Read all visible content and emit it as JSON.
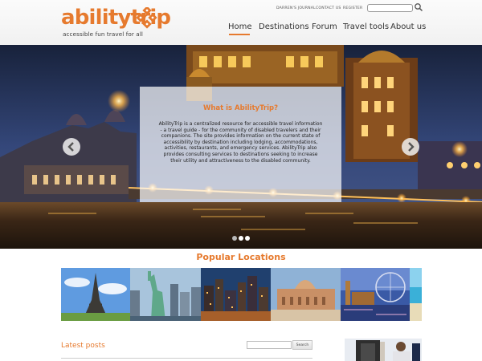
{
  "header": {
    "logo": {
      "word_part1": "ability",
      "word_part2": "trip",
      "tagline": "accessible fun travel for all"
    },
    "utility_links": [
      "DARREN'S JOURNAL",
      "CONTACT US",
      "REGISTER"
    ],
    "search": {
      "placeholder": ""
    },
    "nav": [
      {
        "label": "Home",
        "active": true
      },
      {
        "label": "Destinations",
        "active": false
      },
      {
        "label": "Forum",
        "active": false
      },
      {
        "label": "Travel tools",
        "active": false
      },
      {
        "label": "About us",
        "active": false
      }
    ]
  },
  "hero": {
    "title": "What is AbilityTrip?",
    "body": "AbilityTrip is a centralized resource for accessible travel information - a travel guide - for the community of disabled travelers and their companions. The site provides information on the current state of accessibility by destination including lodging, accommodations, activities, restaurants, and emergency services. AbilityTrip also provides consulting services to destinations seeking to increase their utility and attractiveness to the disabled community.",
    "slide_count": 3,
    "active_slide": 2
  },
  "popular": {
    "title": "Popular Locations",
    "tiles": [
      "eiffel-tower",
      "statue-of-liberty",
      "city-skyline-at-dusk",
      "domed-temple",
      "london-eye",
      "beach"
    ]
  },
  "latest": {
    "title": "Latest posts",
    "search_button": "Search"
  },
  "colors": {
    "accent": "#e67a2e",
    "text": "#333333"
  }
}
